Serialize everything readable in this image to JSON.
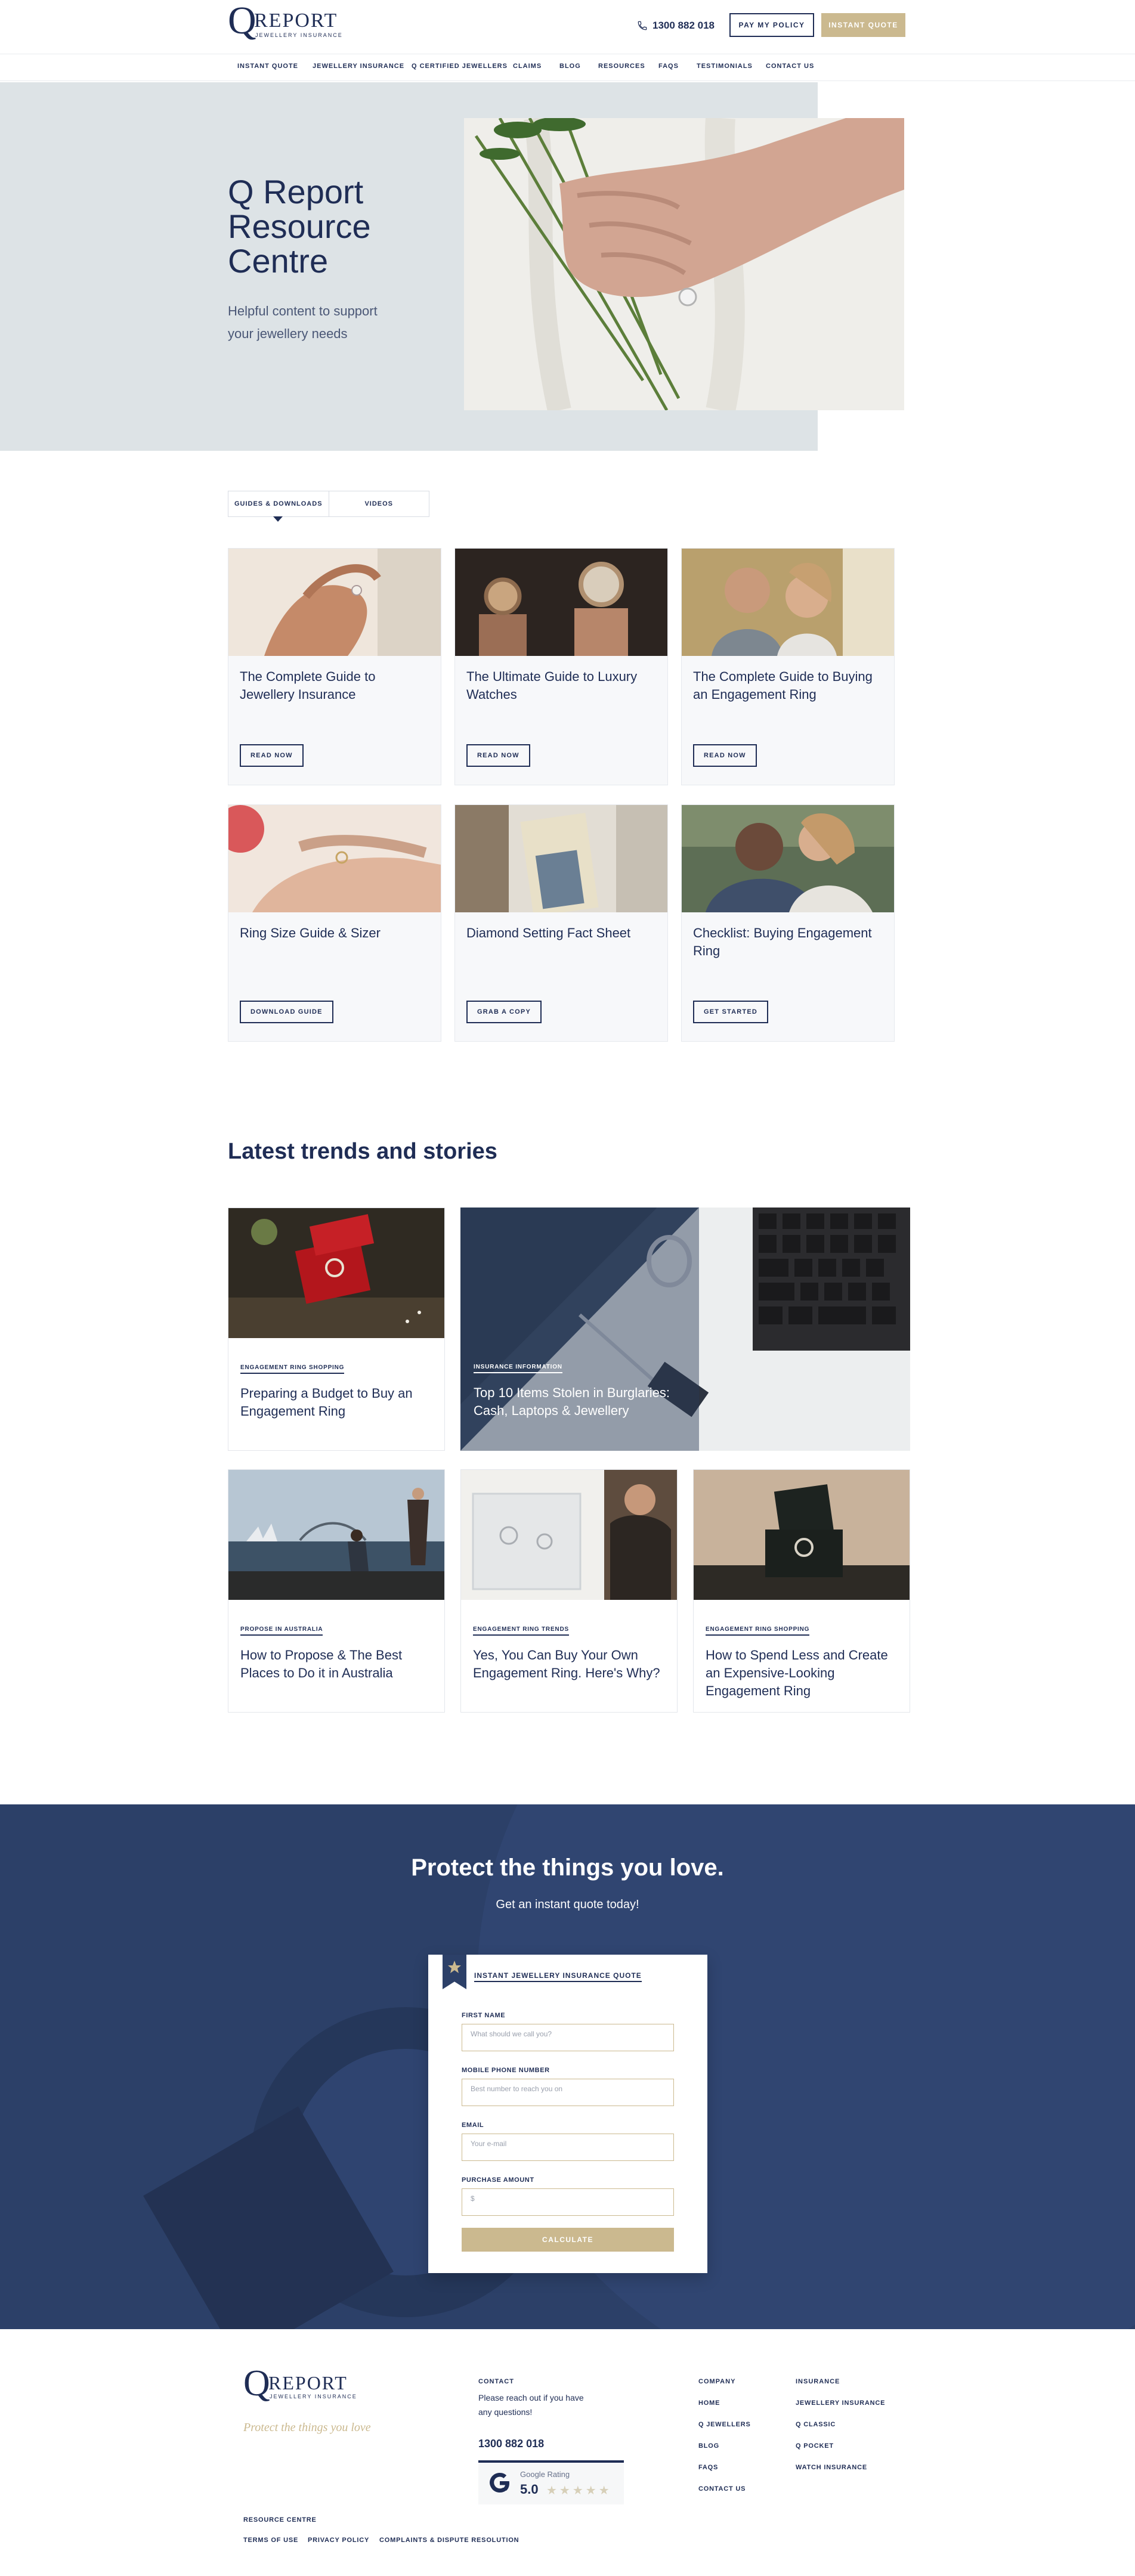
{
  "header": {
    "logo_word": "REPORT",
    "logo_q": "Q",
    "logo_sub": "JEWELLERY INSURANCE",
    "phone": "1300 882 018",
    "pay_button": "PAY MY POLICY",
    "quote_button": "INSTANT QUOTE"
  },
  "nav": {
    "items": [
      "INSTANT QUOTE",
      "JEWELLERY INSURANCE",
      "Q CERTIFIED JEWELLERS",
      "CLAIMS",
      "BLOG",
      "RESOURCES",
      "FAQS",
      "TESTIMONIALS",
      "CONTACT US"
    ]
  },
  "hero": {
    "title_line1": "Q Report",
    "title_line2": "Resource",
    "title_line3": "Centre",
    "subtitle": "Helpful content to support your jewellery needs"
  },
  "tabs": {
    "guides": "GUIDES & DOWNLOADS",
    "videos": "VIDEOS"
  },
  "guides": [
    {
      "title": "The Complete Guide to Jewellery Insurance",
      "button": "READ NOW"
    },
    {
      "title": "The Ultimate Guide to Luxury Watches",
      "button": "READ NOW"
    },
    {
      "title": "The Complete Guide to Buying an Engagement Ring",
      "button": "READ NOW"
    },
    {
      "title": "Ring Size Guide & Sizer",
      "button": "DOWNLOAD GUIDE"
    },
    {
      "title": "Diamond Setting Fact Sheet",
      "button": "GRAB A COPY"
    },
    {
      "title": "Checklist: Buying Engagement Ring",
      "button": "GET STARTED"
    }
  ],
  "trends": {
    "heading": "Latest trends and stories",
    "items": [
      {
        "category": "ENGAGEMENT RING SHOPPING",
        "title": "Preparing a Budget to Buy an Engagement Ring"
      },
      {
        "category": "INSURANCE INFORMATION",
        "title": "Top 10 Items Stolen in Burglaries: Cash, Laptops & Jewellery"
      },
      {
        "category": "PROPOSE IN AUSTRALIA",
        "title": "How to Propose & The Best Places to Do it in Australia"
      },
      {
        "category": "ENGAGEMENT RING TRENDS",
        "title": "Yes, You Can Buy Your Own Engagement Ring. Here's Why?"
      },
      {
        "category": "ENGAGEMENT RING SHOPPING",
        "title": "How to Spend Less and Create an Expensive-Looking Engagement Ring"
      }
    ]
  },
  "cta": {
    "title": "Protect the things you love.",
    "subtitle": "Get an instant quote today!",
    "form_title": "INSTANT JEWELLERY INSURANCE QUOTE",
    "first_name_label": "FIRST NAME",
    "first_name_placeholder": "What should we call you?",
    "mobile_label": "MOBILE PHONE NUMBER",
    "mobile_placeholder": "Best number to reach you on",
    "email_label": "EMAIL",
    "email_placeholder": "Your e-mail",
    "amount_label": "PURCHASE AMOUNT",
    "amount_placeholder": "$",
    "calculate": "CALCULATE"
  },
  "footer": {
    "tagline": "Protect the things you love",
    "contact_heading": "CONTACT",
    "contact_text_1": "Please reach out if you have",
    "contact_text_2": "any questions!",
    "phone": "1300 882 018",
    "google_label": "Google Rating",
    "google_score": "5.0",
    "google_stars": "★★★★★",
    "company_heading": "COMPANY",
    "company_links": [
      "HOME",
      "Q JEWELLERS",
      "BLOG",
      "FAQS",
      "CONTACT US"
    ],
    "insurance_heading": "INSURANCE",
    "insurance_links": [
      "JEWELLERY INSURANCE",
      "Q CLASSIC",
      "Q POCKET",
      "WATCH INSURANCE"
    ],
    "resource_centre": "RESOURCE CENTRE",
    "bottom_links": [
      "TERMS OF USE",
      "PRIVACY POLICY",
      "COMPLAINTS & DISPUTE RESOLUTION"
    ]
  }
}
